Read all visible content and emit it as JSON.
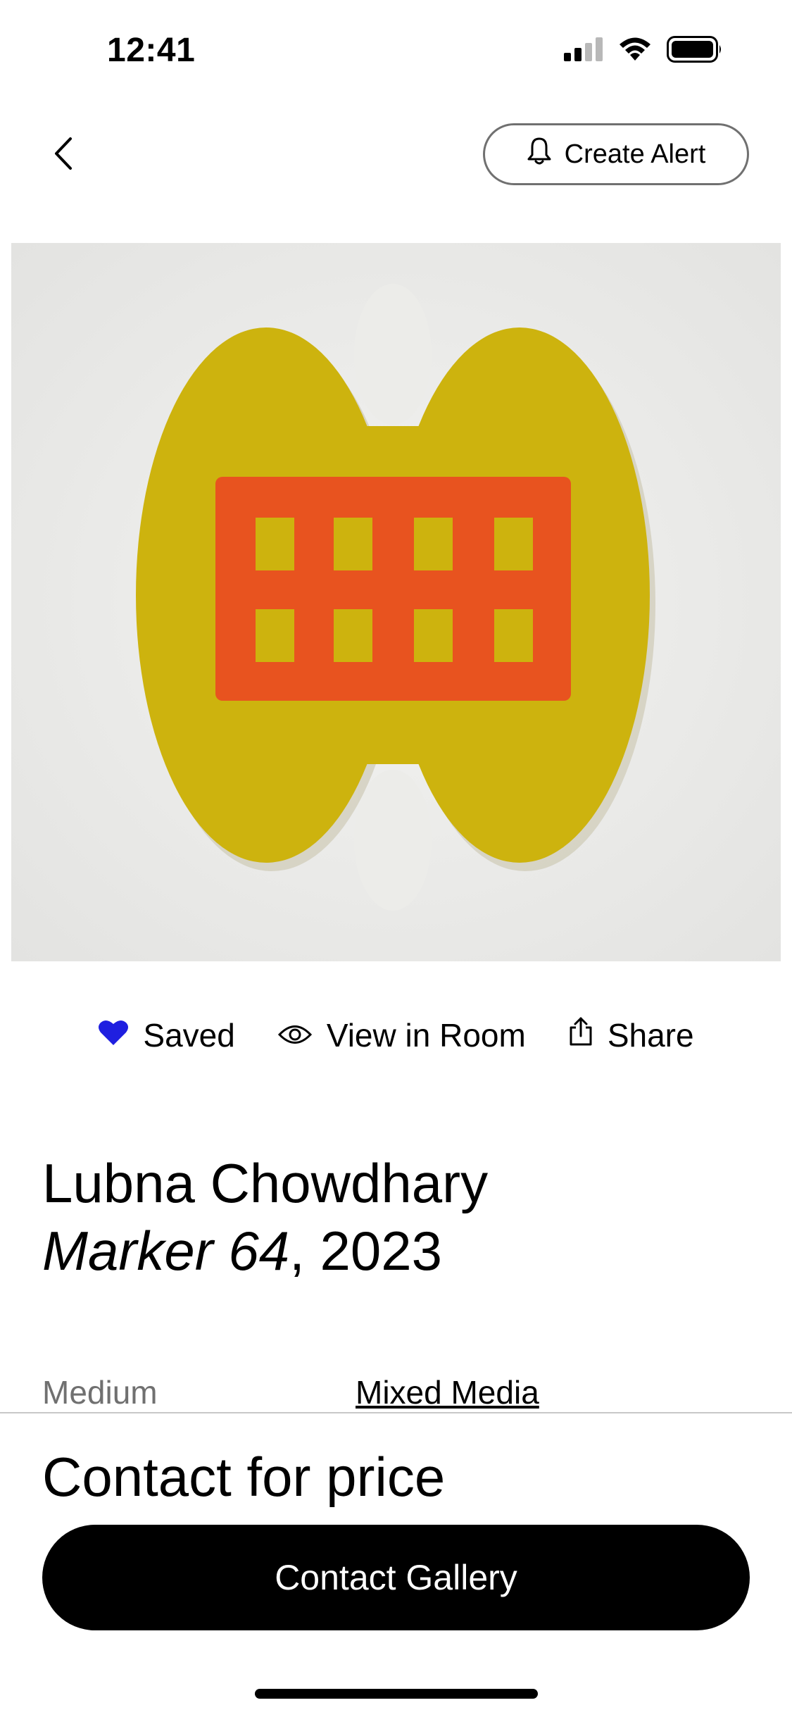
{
  "status_bar": {
    "time": "12:41",
    "icons": [
      "cellular-signal-icon",
      "wifi-icon",
      "battery-icon"
    ]
  },
  "header": {
    "back_icon": "chevron-left-icon",
    "alert_icon": "bell-icon",
    "create_alert_label": "Create Alert"
  },
  "artwork_image": {
    "icon": "artwork-image",
    "colors": {
      "background": "#ededeb",
      "shape": "#cdb30e",
      "grid": "#e8531f"
    }
  },
  "actions": {
    "saved": {
      "label": "Saved",
      "icon": "heart-icon",
      "color": "#1f1fe0"
    },
    "view_in_room": {
      "label": "View in Room",
      "icon": "eye-icon"
    },
    "share": {
      "label": "Share",
      "icon": "share-icon"
    }
  },
  "artwork_info": {
    "artist": "Lubna Chowdhary",
    "title": "Marker 64",
    "year_suffix": ", 2023"
  },
  "details": {
    "medium_label": "Medium",
    "medium_value": "Mixed Media"
  },
  "purchase": {
    "price": "Contact for price",
    "contact_button_label": "Contact Gallery"
  }
}
